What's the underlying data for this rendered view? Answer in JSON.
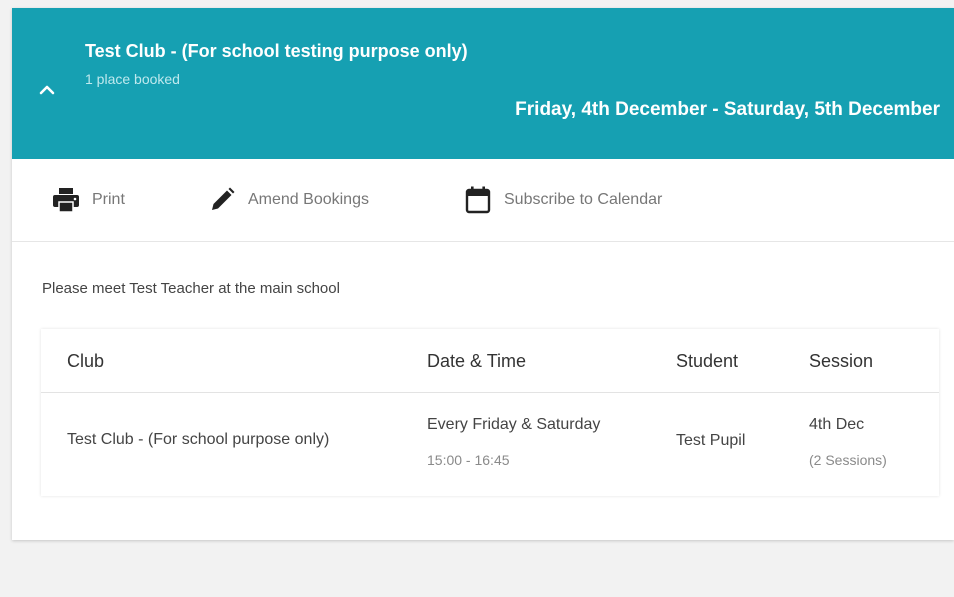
{
  "header": {
    "club_title": "Test Club - (For school testing purpose only)",
    "places_booked": "1 place booked",
    "date_range": "Friday, 4th December - Saturday, 5th December",
    "color": "#16a0b2"
  },
  "toolbar": {
    "print_label": "Print",
    "amend_label": "Amend Bookings",
    "subscribe_label": "Subscribe to Calendar"
  },
  "notice": "Please meet Test Teacher at the main school",
  "table": {
    "headers": {
      "club": "Club",
      "date_time": "Date & Time",
      "student": "Student",
      "session": "Session"
    },
    "rows": [
      {
        "club": "Test Club - (For school purpose only)",
        "schedule": "Every Friday & Saturday",
        "time": "15:00 - 16:45",
        "student": "Test Pupil",
        "session_date": "4th Dec",
        "session_count": "(2 Sessions)"
      }
    ]
  }
}
